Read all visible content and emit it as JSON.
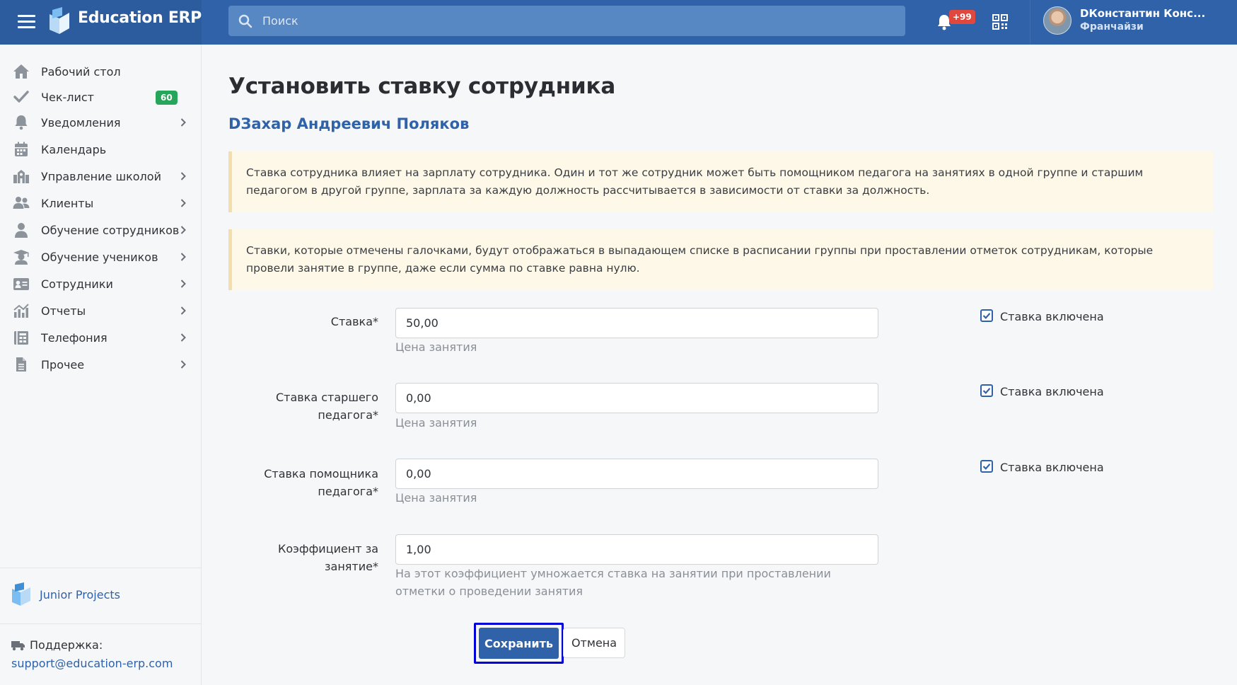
{
  "app": {
    "title": "Education ERP"
  },
  "search": {
    "placeholder": "Поиск"
  },
  "notifications": {
    "badge": "+99"
  },
  "user": {
    "name": "DКонстантин Конс...",
    "role": "Франчайзи"
  },
  "sidebar": {
    "items": [
      {
        "label": "Рабочий стол",
        "icon": "home-icon",
        "chevron": false
      },
      {
        "label": "Чек-лист",
        "icon": "check-icon",
        "badge": "60",
        "chevron": false
      },
      {
        "label": "Уведомления",
        "icon": "bell-icon",
        "chevron": true
      },
      {
        "label": "Календарь",
        "icon": "calendar-icon",
        "chevron": false
      },
      {
        "label": "Управление школой",
        "icon": "school-icon",
        "chevron": true
      },
      {
        "label": "Клиенты",
        "icon": "users-icon",
        "chevron": true
      },
      {
        "label": "Обучение сотрудников",
        "icon": "teacher-icon",
        "chevron": true
      },
      {
        "label": "Обучение учеников",
        "icon": "graduation-cap-icon",
        "chevron": true
      },
      {
        "label": "Сотрудники",
        "icon": "id-card-icon",
        "chevron": true
      },
      {
        "label": "Отчеты",
        "icon": "chart-icon",
        "chevron": true
      },
      {
        "label": "Телефония",
        "icon": "phonebook-icon",
        "chevron": true
      },
      {
        "label": "Прочее",
        "icon": "document-icon",
        "chevron": true
      }
    ],
    "footer_brand": "Junior Projects",
    "support_label": "Поддержка:",
    "support_email": "support@education-erp.com"
  },
  "main": {
    "title": "Установить ставку сотрудника",
    "employee_name": "DЗахар Андреевич Поляков",
    "notes": [
      "Ставка сотрудника влияет на зарплату сотрудника. Один и тот же сотрудник может быть помощником педагога на занятиях в одной группе и старшим педагогом в другой группе, зарплата за каждую должность рассчитывается в зависимости от ставки за должность.",
      "Ставки, которые отмечены галочками, будут отображаться в выпадающем списке в расписании группы при проставлении отметок сотрудникам, которые провели занятие в группе, даже если сумма по ставке равна нулю."
    ],
    "fields": [
      {
        "label": "Ставка*",
        "value": "50,00",
        "help": "Цена занятия",
        "checkbox_label": "Ставка включена",
        "checked": true
      },
      {
        "label": "Ставка старшего педагога*",
        "value": "0,00",
        "help": "Цена занятия",
        "checkbox_label": "Ставка включена",
        "checked": true
      },
      {
        "label": "Ставка помощника педагога*",
        "value": "0,00",
        "help": "Цена занятия",
        "checkbox_label": "Ставка включена",
        "checked": true
      },
      {
        "label": "Коэффициент за занятие*",
        "value": "1,00",
        "help": "На этот коэффициент умножается ставка на занятии при проставлении отметки о проведении занятия"
      }
    ],
    "save_label": "Сохранить",
    "cancel_label": "Отмена"
  },
  "colors": {
    "brand": "#2f62a8",
    "topbar": "#2f62a8",
    "badge_red": "#e0483e",
    "badge_green": "#26a65b",
    "note_bg": "#fdf8e7"
  }
}
